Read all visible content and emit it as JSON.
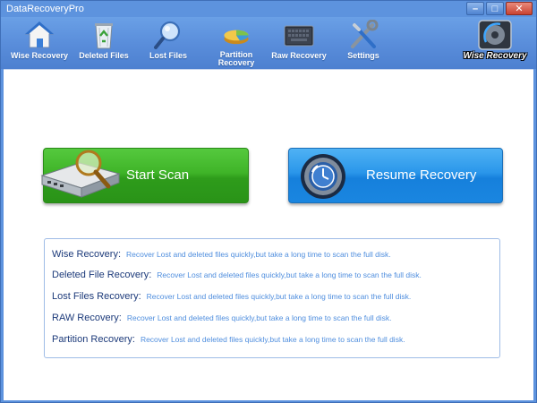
{
  "window": {
    "title": "DataRecoveryPro",
    "minimize": "–",
    "maximize": "□",
    "close": "✕"
  },
  "toolbar": {
    "items": [
      {
        "label": "Wise Recovery",
        "icon": "home-icon"
      },
      {
        "label": "Deleted Files",
        "icon": "recycle-bin-icon"
      },
      {
        "label": "Lost Files",
        "icon": "magnifier-icon"
      },
      {
        "label": "Partition\nRecovery",
        "icon": "pie-chart-icon"
      },
      {
        "label": "Raw Recovery",
        "icon": "keyboard-icon"
      },
      {
        "label": "Settings",
        "icon": "tools-icon"
      }
    ],
    "logo_text": "Wise Recovery"
  },
  "actions": {
    "start_scan": "Start  Scan",
    "resume_recovery": "Resume Recovery"
  },
  "info": [
    {
      "title": "Wise Recovery:",
      "desc": "Recover Lost and deleted files quickly,but take a long time to scan the full disk."
    },
    {
      "title": "Deleted File Recovery:",
      "desc": "Recover Lost and deleted files quickly,but take a long time to scan the full disk."
    },
    {
      "title": "Lost Files Recovery:",
      "desc": "Recover Lost and deleted files quickly,but take a long time to scan the full disk."
    },
    {
      "title": "RAW Recovery:",
      "desc": "Recover Lost and deleted files quickly,but take a long time to scan the full disk."
    },
    {
      "title": "Partition Recovery:",
      "desc": "Recover Lost and deleted files quickly,but take a long time to scan the full disk."
    }
  ],
  "colors": {
    "window_blue": "#5d93de",
    "start_green": "#3fb428",
    "resume_blue": "#2a96ea",
    "info_title": "#1c3a7a",
    "info_desc": "#4f8ede"
  }
}
